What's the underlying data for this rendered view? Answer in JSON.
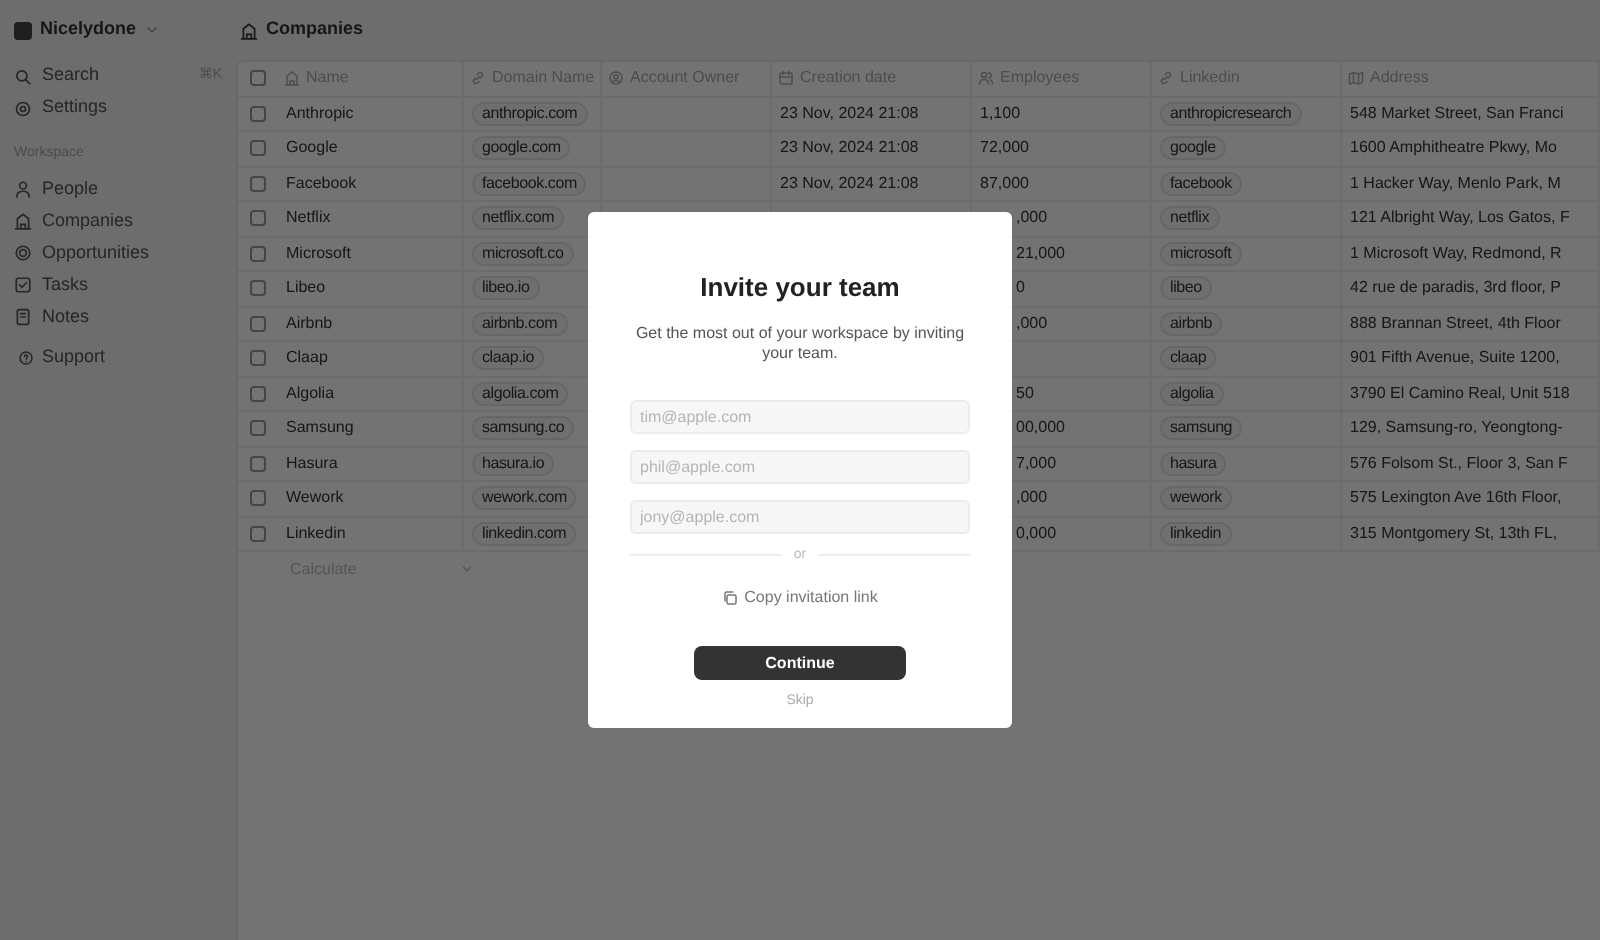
{
  "sidebar": {
    "workspace": "Nicelydone",
    "tools": [
      {
        "label": "Search",
        "shortcut": "⌘K"
      },
      {
        "label": "Settings"
      }
    ],
    "section_label": "Workspace",
    "nav": [
      {
        "label": "People"
      },
      {
        "label": "Companies"
      },
      {
        "label": "Opportunities"
      },
      {
        "label": "Tasks"
      },
      {
        "label": "Notes"
      }
    ],
    "support": "Support"
  },
  "header": {
    "title": "Companies"
  },
  "table": {
    "all_checked": false,
    "columns": [
      "Name",
      "Domain Name",
      "Account Owner",
      "Creation date",
      "Employees",
      "Linkedin",
      "Address"
    ],
    "rows": [
      {
        "checked": false,
        "name": "Anthropic",
        "domain": "anthropic.com",
        "creation_date": "23 Nov, 2024 21:08",
        "employees": "1,100",
        "linkedin": "anthropicresearch",
        "address": "548 Market Street, San Franci"
      },
      {
        "checked": false,
        "name": "Google",
        "domain": "google.com",
        "creation_date": "23 Nov, 2024 21:08",
        "employees": "72,000",
        "linkedin": "google",
        "address": "1600 Amphitheatre Pkwy, Mo"
      },
      {
        "checked": false,
        "name": "Facebook",
        "domain": "facebook.com",
        "creation_date": "23 Nov, 2024 21:08",
        "employees": "87,000",
        "linkedin": "facebook",
        "address": "1 Hacker Way, Menlo Park, M"
      },
      {
        "checked": false,
        "name": "Netflix",
        "domain": "netflix.com",
        "employees": ",000",
        "linkedin": "netflix",
        "address": "121 Albright Way, Los Gatos, F"
      },
      {
        "checked": false,
        "name": "Microsoft",
        "domain": "microsoft.co",
        "employees": "21,000",
        "linkedin": "microsoft",
        "address": "1 Microsoft Way, Redmond, R"
      },
      {
        "checked": false,
        "name": "Libeo",
        "domain": "libeo.io",
        "employees": "0",
        "linkedin": "libeo",
        "address": "42 rue de paradis, 3rd floor, P"
      },
      {
        "checked": false,
        "name": "Airbnb",
        "domain": "airbnb.com",
        "employees": ",000",
        "linkedin": "airbnb",
        "address": "888 Brannan Street, 4th Floor"
      },
      {
        "checked": false,
        "name": "Claap",
        "domain": "claap.io",
        "linkedin": "claap",
        "address": "901 Fifth Avenue, Suite 1200,"
      },
      {
        "checked": false,
        "name": "Algolia",
        "domain": "algolia.com",
        "employees": "50",
        "linkedin": "algolia",
        "address": "3790 El Camino Real, Unit 518"
      },
      {
        "checked": false,
        "name": "Samsung",
        "domain": "samsung.co",
        "employees": "00,000",
        "linkedin": "samsung",
        "address": "129, Samsung-ro, Yeongtong-"
      },
      {
        "checked": false,
        "name": "Hasura",
        "domain": "hasura.io",
        "employees": "7,000",
        "linkedin": "hasura",
        "address": "576 Folsom St., Floor 3, San F"
      },
      {
        "checked": false,
        "name": "Wework",
        "domain": "wework.com",
        "employees": ",000",
        "linkedin": "wework",
        "address": "575 Lexington Ave 16th Floor,"
      },
      {
        "checked": false,
        "name": "Linkedin",
        "domain": "linkedin.com",
        "employees": "0,000",
        "linkedin": "linkedin",
        "address": "315 Montgomery St, 13th FL,"
      }
    ],
    "footer": "Calculate"
  },
  "modal": {
    "title": "Invite your team",
    "subtitle": "Get the most out of your workspace by inviting your team.",
    "fields": [
      {
        "placeholder": "tim@apple.com"
      },
      {
        "placeholder": "phil@apple.com"
      },
      {
        "placeholder": "jony@apple.com"
      }
    ],
    "divider": "or",
    "copy_link": "Copy invitation link",
    "primary": "Continue",
    "secondary": "Skip"
  }
}
